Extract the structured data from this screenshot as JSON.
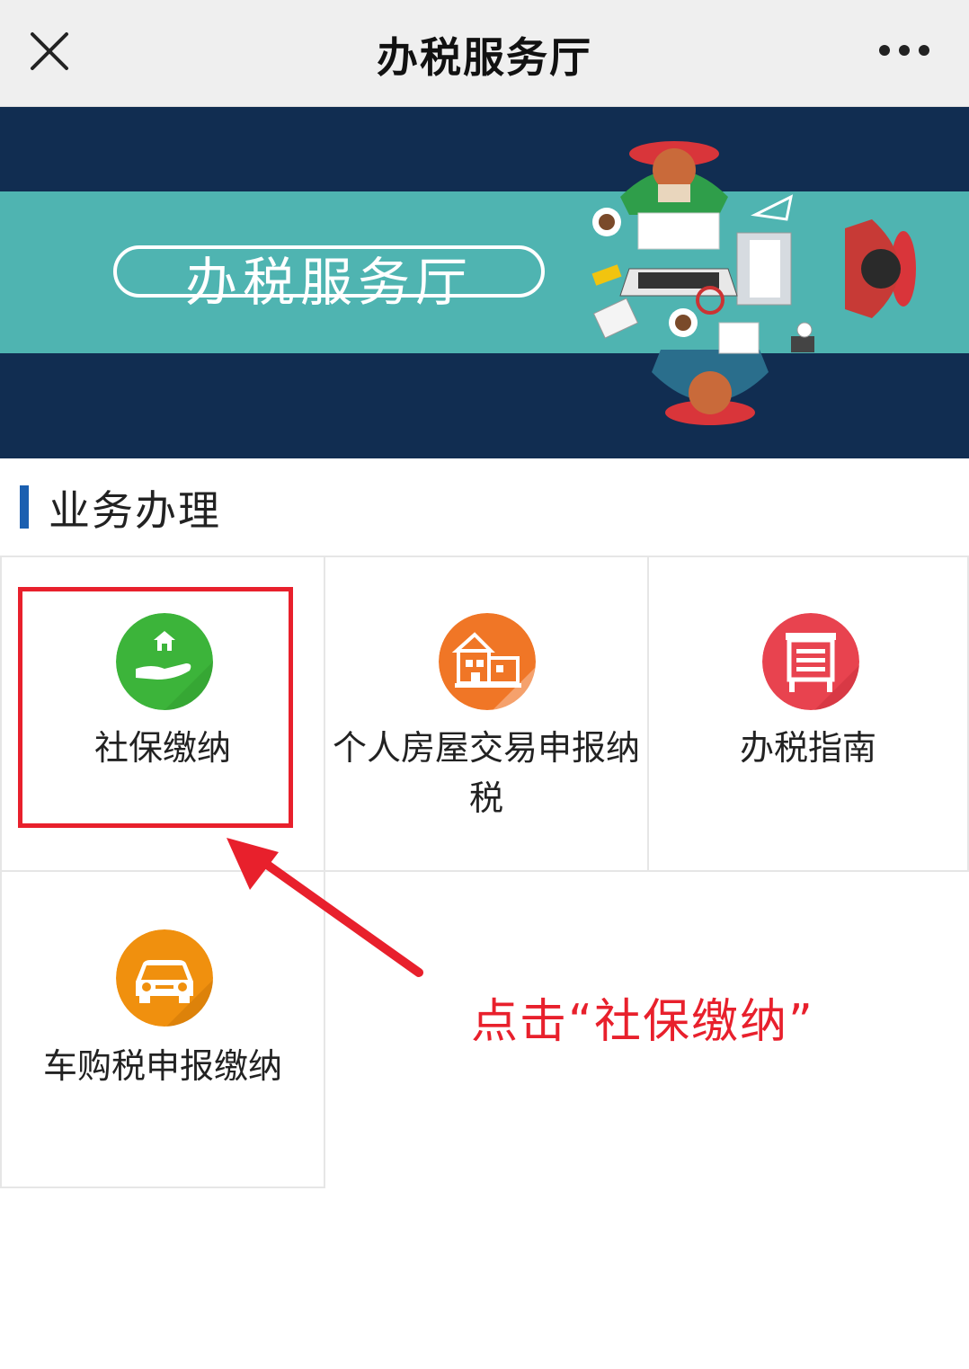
{
  "navbar": {
    "title": "办税服务厅",
    "close_icon": "close-icon",
    "more_icon": "more-icon"
  },
  "banner": {
    "title": "办税服务厅",
    "colors": {
      "dark": "#112d51",
      "band": "#4fb4b1"
    }
  },
  "section": {
    "title": "业务办理",
    "accent": "#1b5fb0"
  },
  "services": [
    {
      "label": "社保缴纳",
      "icon": "house-in-hand-icon",
      "color": "#3cb43a"
    },
    {
      "label": "个人房屋交易申报纳税",
      "icon": "building-icon",
      "color": "#f07626"
    },
    {
      "label": "办税指南",
      "icon": "guide-board-icon",
      "color": "#e8434f"
    },
    {
      "label": "车购税申报缴纳",
      "icon": "car-icon",
      "color": "#f0900e"
    }
  ],
  "annotation": {
    "text": "点击“社保缴纳”",
    "color": "#e8202c"
  }
}
